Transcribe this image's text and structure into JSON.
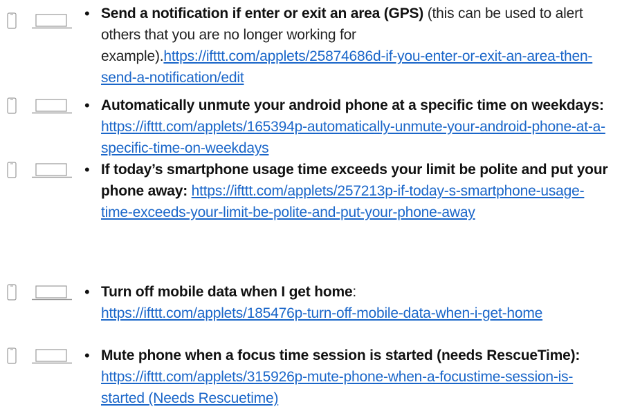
{
  "items": [
    {
      "title": "Send a notification if enter or exit an area (GPS)",
      "description": " (this can be used to alert others that you are no longer working for example).",
      "link": "https://ifttt.com/applets/25874686d-if-you-enter-or-exit-an-area-then-send-a-notification/edit"
    },
    {
      "title": "Automatically unmute your android phone at a specific time on weekdays:",
      "description": " ",
      "link": "https://ifttt.com/applets/165394p-automatically-unmute-your-android-phone-at-a-specific-time-on-weekdays"
    },
    {
      "title": "If today’s smartphone usage time exceeds your limit be polite and put your phone away:",
      "description": " ",
      "link": "https://ifttt.com/applets/257213p-if-today-s-smartphone-usage-time-exceeds-your-limit-be-polite-and-put-your-phone-away"
    },
    {
      "title": "Turn off mobile data when I get home",
      "description": ": ",
      "link": "https://ifttt.com/applets/185476p-turn-off-mobile-data-when-i-get-home"
    },
    {
      "title": "Mute phone when a focus time session is started (needs RescueTime):",
      "description": " ",
      "link": "https://ifttt.com/applets/315926p-mute-phone-when-a-focustime-session-is-started (Needs Rescuetime)"
    }
  ],
  "icons": [
    "phone-icon",
    "laptop-icon"
  ],
  "colors": {
    "link": "#1a66c9",
    "text": "#222222",
    "icon": "#9a9a9a"
  }
}
